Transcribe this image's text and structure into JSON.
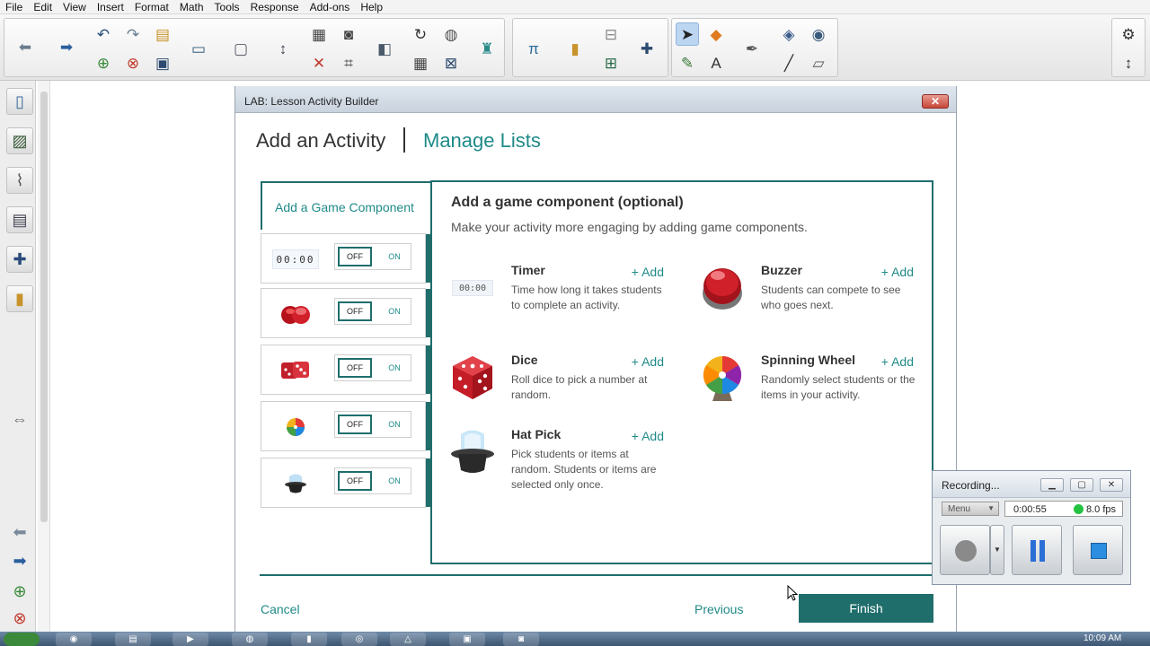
{
  "menu": [
    "File",
    "Edit",
    "View",
    "Insert",
    "Format",
    "Math",
    "Tools",
    "Response",
    "Add-ons",
    "Help"
  ],
  "lab": {
    "title": "LAB: Lesson Activity Builder",
    "close_glyph": "✕",
    "tab_add": "Add an Activity",
    "tab_manage": "Manage Lists",
    "add_game_component": "Add a Game Component",
    "panel_title": "Add a game component (optional)",
    "panel_subtitle": "Make your activity more engaging by adding game components.",
    "toggle_off": "OFF",
    "toggle_on": "ON",
    "timer_display": "00:00",
    "components": [
      {
        "name": "Timer",
        "add": "+ Add",
        "desc": "Time how long it takes students to complete an activity."
      },
      {
        "name": "Buzzer",
        "add": "+ Add",
        "desc": "Students can compete to see who goes next."
      },
      {
        "name": "Dice",
        "add": "+ Add",
        "desc": "Roll dice to pick a number at random."
      },
      {
        "name": "Spinning Wheel",
        "add": "+ Add",
        "desc": "Randomly select students or the items in your activity."
      },
      {
        "name": "Hat Pick",
        "add": "+ Add",
        "desc": "Pick students or items at random. Students or items are selected only once."
      }
    ],
    "cancel": "Cancel",
    "previous": "Previous",
    "finish": "Finish"
  },
  "recording": {
    "title": "Recording...",
    "menu": "Menu",
    "time": "0:00:55",
    "fps": "8.0 fps"
  },
  "taskbar": {
    "clock": "10:09 AM"
  },
  "colors": {
    "accent": "#1f8a88",
    "accent_dark": "#1f6e6c"
  }
}
